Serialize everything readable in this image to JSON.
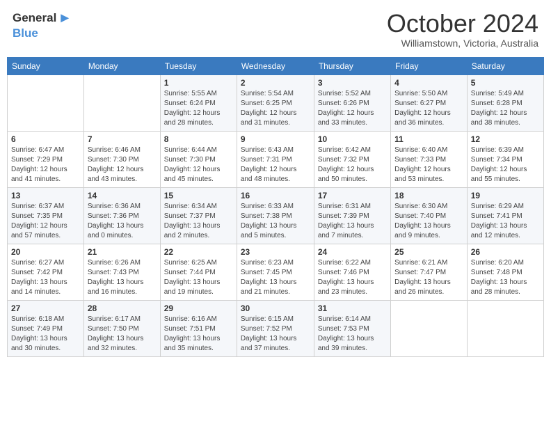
{
  "header": {
    "logo_general": "General",
    "logo_blue": "Blue",
    "month_title": "October 2024",
    "subtitle": "Williamstown, Victoria, Australia"
  },
  "days_of_week": [
    "Sunday",
    "Monday",
    "Tuesday",
    "Wednesday",
    "Thursday",
    "Friday",
    "Saturday"
  ],
  "weeks": [
    [
      {
        "day": "",
        "info": ""
      },
      {
        "day": "",
        "info": ""
      },
      {
        "day": "1",
        "info": "Sunrise: 5:55 AM\nSunset: 6:24 PM\nDaylight: 12 hours and 28 minutes."
      },
      {
        "day": "2",
        "info": "Sunrise: 5:54 AM\nSunset: 6:25 PM\nDaylight: 12 hours and 31 minutes."
      },
      {
        "day": "3",
        "info": "Sunrise: 5:52 AM\nSunset: 6:26 PM\nDaylight: 12 hours and 33 minutes."
      },
      {
        "day": "4",
        "info": "Sunrise: 5:50 AM\nSunset: 6:27 PM\nDaylight: 12 hours and 36 minutes."
      },
      {
        "day": "5",
        "info": "Sunrise: 5:49 AM\nSunset: 6:28 PM\nDaylight: 12 hours and 38 minutes."
      }
    ],
    [
      {
        "day": "6",
        "info": "Sunrise: 6:47 AM\nSunset: 7:29 PM\nDaylight: 12 hours and 41 minutes."
      },
      {
        "day": "7",
        "info": "Sunrise: 6:46 AM\nSunset: 7:30 PM\nDaylight: 12 hours and 43 minutes."
      },
      {
        "day": "8",
        "info": "Sunrise: 6:44 AM\nSunset: 7:30 PM\nDaylight: 12 hours and 45 minutes."
      },
      {
        "day": "9",
        "info": "Sunrise: 6:43 AM\nSunset: 7:31 PM\nDaylight: 12 hours and 48 minutes."
      },
      {
        "day": "10",
        "info": "Sunrise: 6:42 AM\nSunset: 7:32 PM\nDaylight: 12 hours and 50 minutes."
      },
      {
        "day": "11",
        "info": "Sunrise: 6:40 AM\nSunset: 7:33 PM\nDaylight: 12 hours and 53 minutes."
      },
      {
        "day": "12",
        "info": "Sunrise: 6:39 AM\nSunset: 7:34 PM\nDaylight: 12 hours and 55 minutes."
      }
    ],
    [
      {
        "day": "13",
        "info": "Sunrise: 6:37 AM\nSunset: 7:35 PM\nDaylight: 12 hours and 57 minutes."
      },
      {
        "day": "14",
        "info": "Sunrise: 6:36 AM\nSunset: 7:36 PM\nDaylight: 13 hours and 0 minutes."
      },
      {
        "day": "15",
        "info": "Sunrise: 6:34 AM\nSunset: 7:37 PM\nDaylight: 13 hours and 2 minutes."
      },
      {
        "day": "16",
        "info": "Sunrise: 6:33 AM\nSunset: 7:38 PM\nDaylight: 13 hours and 5 minutes."
      },
      {
        "day": "17",
        "info": "Sunrise: 6:31 AM\nSunset: 7:39 PM\nDaylight: 13 hours and 7 minutes."
      },
      {
        "day": "18",
        "info": "Sunrise: 6:30 AM\nSunset: 7:40 PM\nDaylight: 13 hours and 9 minutes."
      },
      {
        "day": "19",
        "info": "Sunrise: 6:29 AM\nSunset: 7:41 PM\nDaylight: 13 hours and 12 minutes."
      }
    ],
    [
      {
        "day": "20",
        "info": "Sunrise: 6:27 AM\nSunset: 7:42 PM\nDaylight: 13 hours and 14 minutes."
      },
      {
        "day": "21",
        "info": "Sunrise: 6:26 AM\nSunset: 7:43 PM\nDaylight: 13 hours and 16 minutes."
      },
      {
        "day": "22",
        "info": "Sunrise: 6:25 AM\nSunset: 7:44 PM\nDaylight: 13 hours and 19 minutes."
      },
      {
        "day": "23",
        "info": "Sunrise: 6:23 AM\nSunset: 7:45 PM\nDaylight: 13 hours and 21 minutes."
      },
      {
        "day": "24",
        "info": "Sunrise: 6:22 AM\nSunset: 7:46 PM\nDaylight: 13 hours and 23 minutes."
      },
      {
        "day": "25",
        "info": "Sunrise: 6:21 AM\nSunset: 7:47 PM\nDaylight: 13 hours and 26 minutes."
      },
      {
        "day": "26",
        "info": "Sunrise: 6:20 AM\nSunset: 7:48 PM\nDaylight: 13 hours and 28 minutes."
      }
    ],
    [
      {
        "day": "27",
        "info": "Sunrise: 6:18 AM\nSunset: 7:49 PM\nDaylight: 13 hours and 30 minutes."
      },
      {
        "day": "28",
        "info": "Sunrise: 6:17 AM\nSunset: 7:50 PM\nDaylight: 13 hours and 32 minutes."
      },
      {
        "day": "29",
        "info": "Sunrise: 6:16 AM\nSunset: 7:51 PM\nDaylight: 13 hours and 35 minutes."
      },
      {
        "day": "30",
        "info": "Sunrise: 6:15 AM\nSunset: 7:52 PM\nDaylight: 13 hours and 37 minutes."
      },
      {
        "day": "31",
        "info": "Sunrise: 6:14 AM\nSunset: 7:53 PM\nDaylight: 13 hours and 39 minutes."
      },
      {
        "day": "",
        "info": ""
      },
      {
        "day": "",
        "info": ""
      }
    ]
  ]
}
